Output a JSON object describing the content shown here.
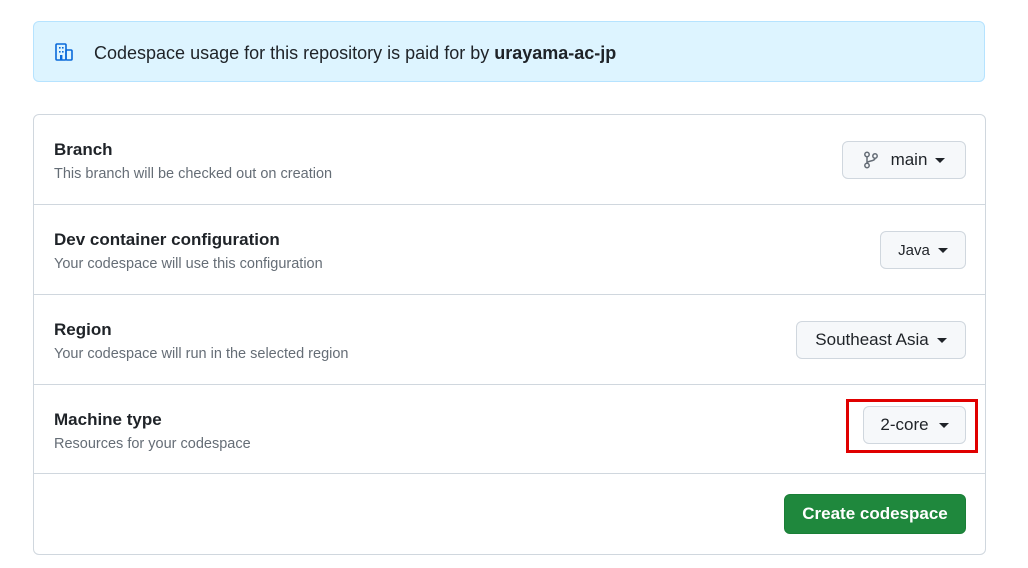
{
  "banner": {
    "text": "Codespace usage for this repository is paid for by ",
    "owner": "urayama-ac-jp",
    "icon": "organization-icon"
  },
  "rows": [
    {
      "title": "Branch",
      "description": "This branch will be checked out on creation",
      "value": "main",
      "icon": "git-branch-icon"
    },
    {
      "title": "Dev container configuration",
      "description": "Your codespace will use this configuration",
      "value": "Java"
    },
    {
      "title": "Region",
      "description": "Your codespace will run in the selected region",
      "value": "Southeast Asia"
    },
    {
      "title": "Machine type",
      "description": "Resources for your codespace",
      "value": "2-core"
    }
  ],
  "actions": {
    "create_label": "Create codespace"
  },
  "colors": {
    "banner_bg": "#ddf4ff",
    "primary": "#1f883d",
    "highlight": "#e00000"
  }
}
